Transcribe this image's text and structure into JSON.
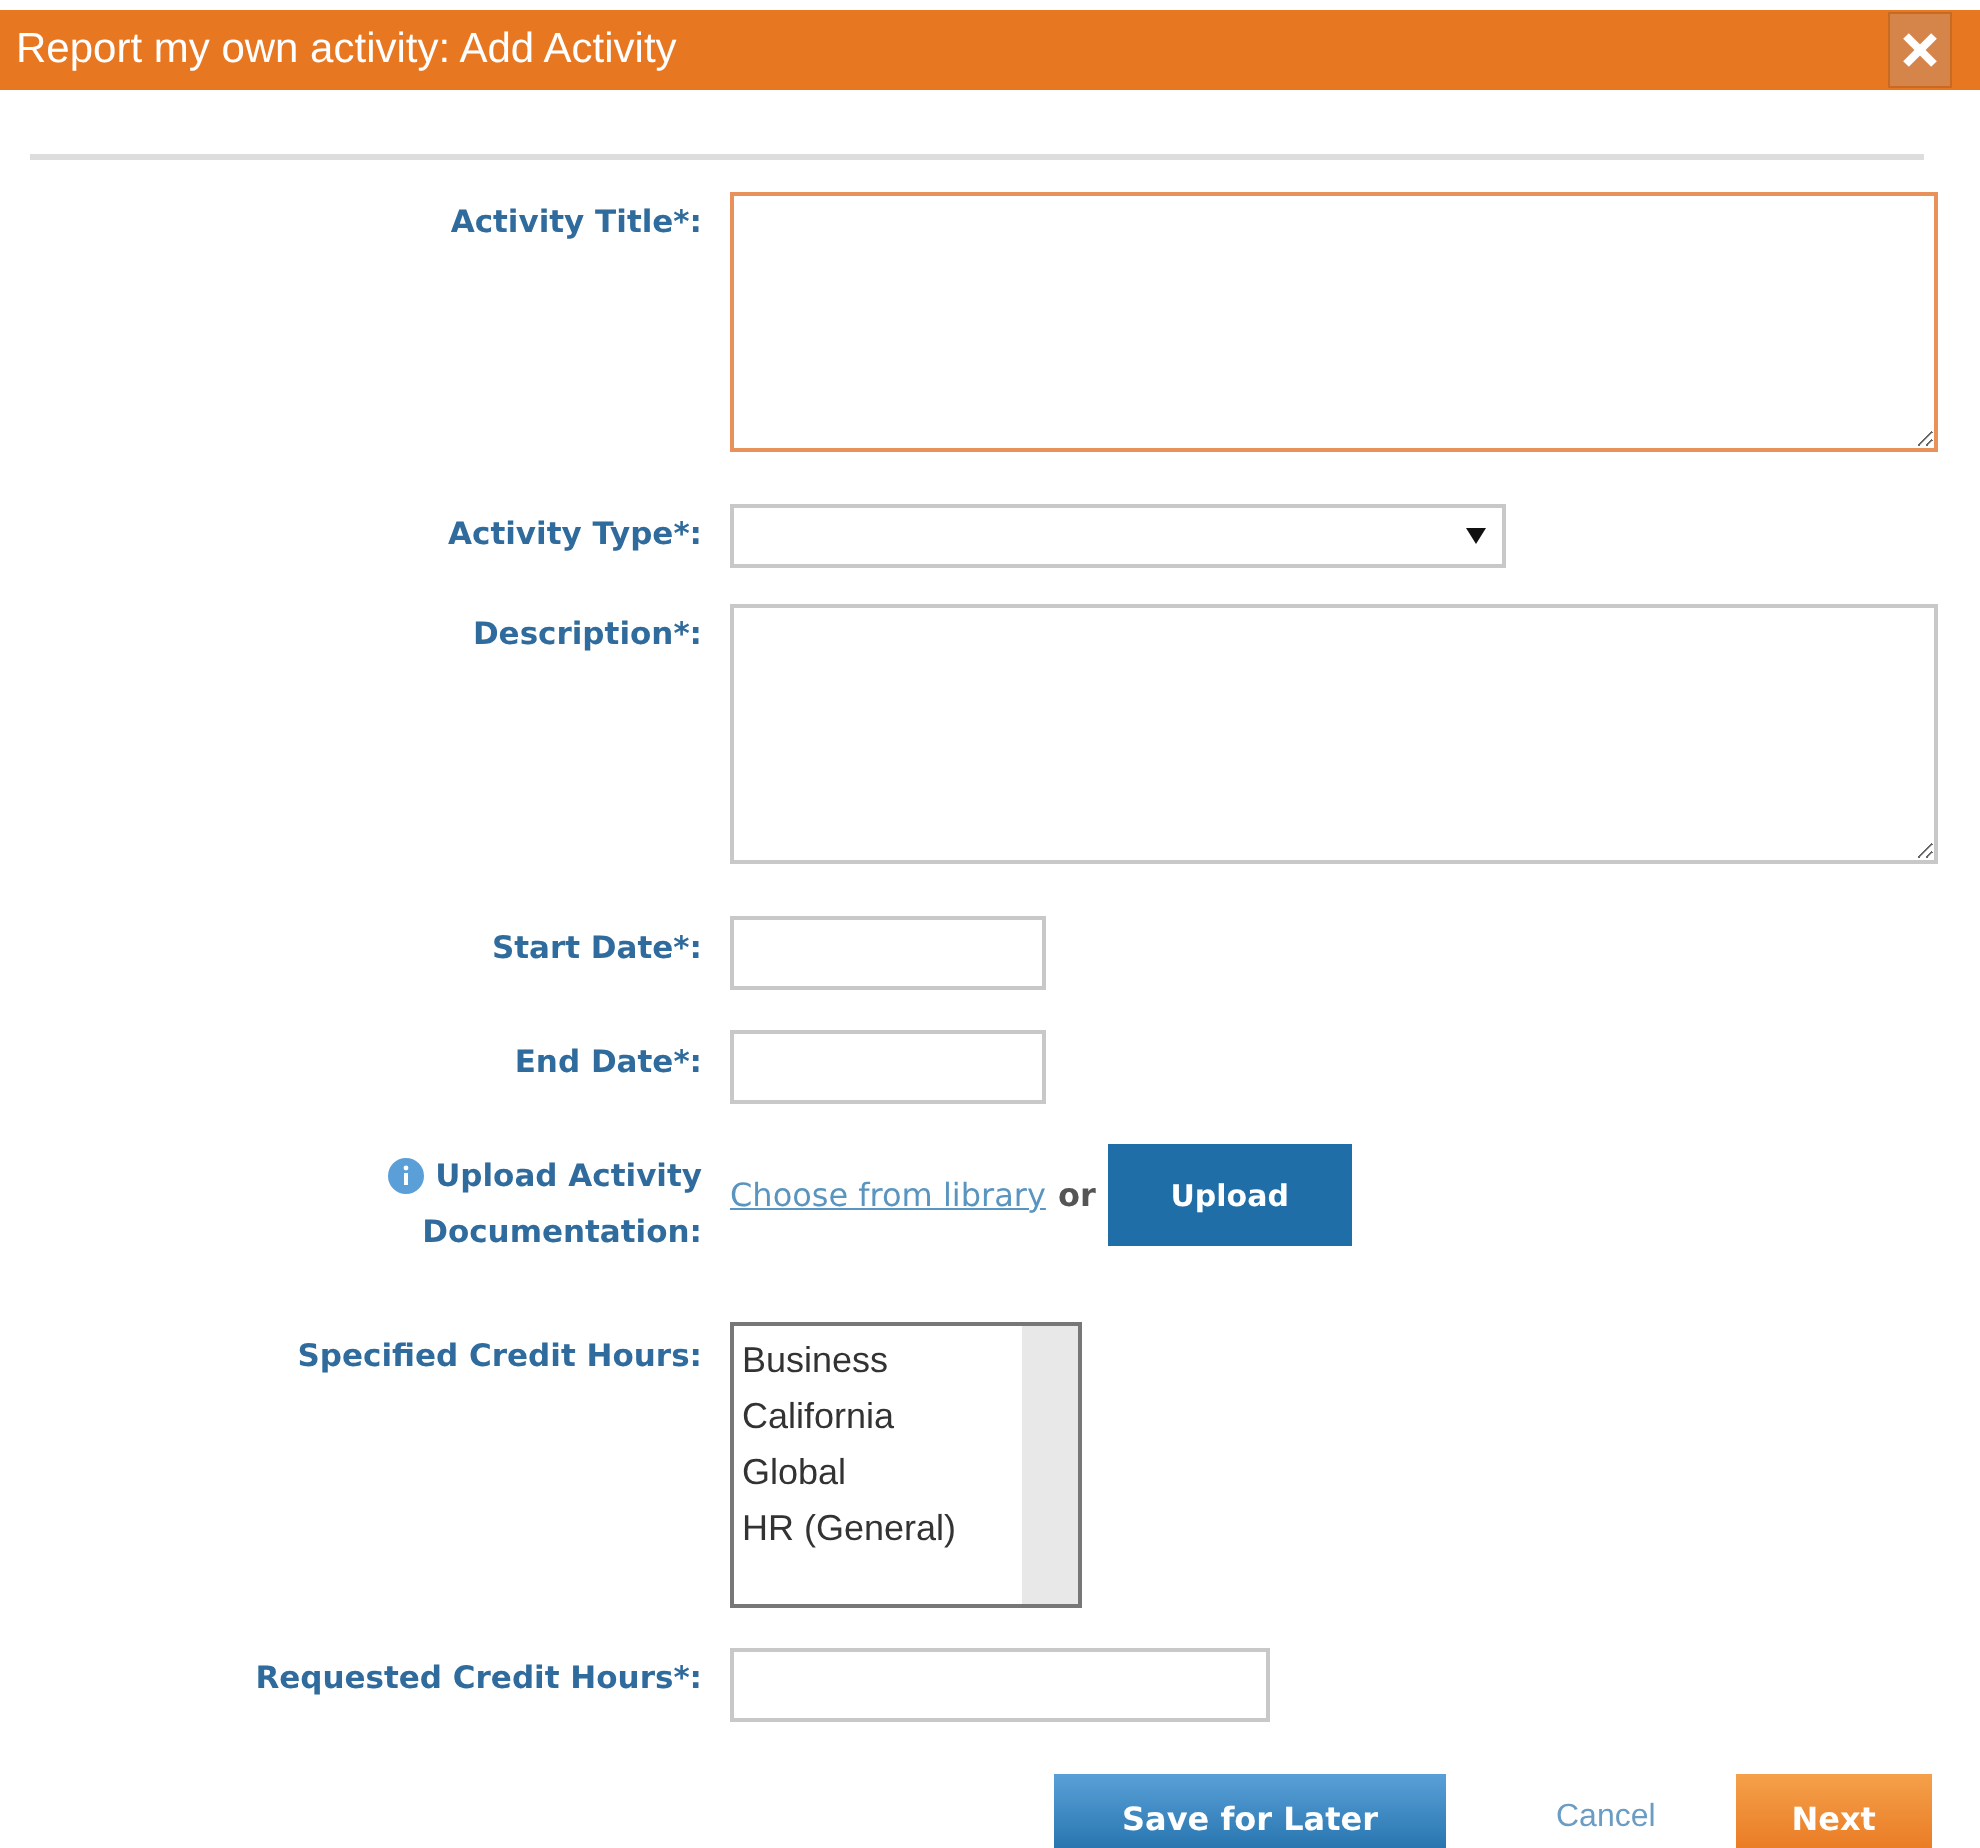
{
  "dialog": {
    "title": "Report my own activity: Add Activity"
  },
  "fields": [
    {
      "kind": "textarea",
      "label": "Activity Title*:",
      "focused": true
    },
    {
      "kind": "select",
      "label": "Activity Type*:"
    },
    {
      "kind": "textarea",
      "label": "Description*:",
      "focused": false
    },
    {
      "kind": "date",
      "label": "Start Date*:"
    },
    {
      "kind": "date",
      "label": "End Date*:"
    },
    {
      "kind": "upload",
      "label_lines": [
        "Upload Activity",
        "Documentation:"
      ],
      "link": "Choose from library",
      "separator": "or",
      "button": "Upload"
    },
    {
      "kind": "listbox",
      "label": "Specified Credit Hours:",
      "options": [
        "Business",
        "California",
        "Global",
        "HR (General)"
      ]
    },
    {
      "kind": "text",
      "label": "Requested Credit Hours*:"
    }
  ],
  "buttons": [
    {
      "kind": "primary",
      "label": "Save for Later"
    },
    {
      "kind": "link",
      "label": "Cancel"
    },
    {
      "kind": "accent",
      "label": "Next"
    }
  ]
}
